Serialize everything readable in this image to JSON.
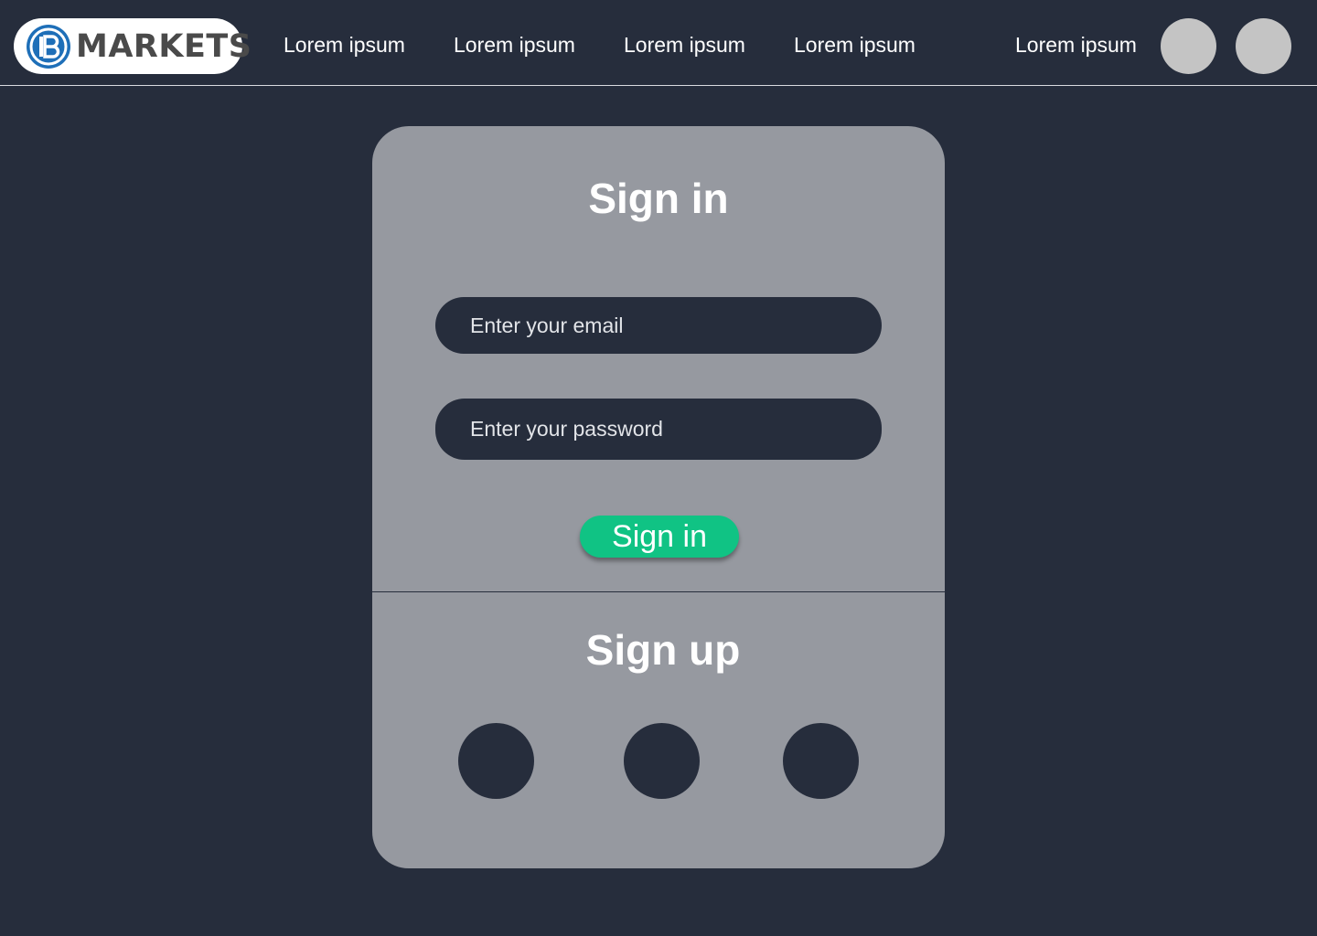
{
  "header": {
    "logo": {
      "text": "MARKETS",
      "mark_color": "#1e6fb8"
    },
    "nav": [
      {
        "label": "Lorem ipsum"
      },
      {
        "label": "Lorem ipsum"
      },
      {
        "label": "Lorem ipsum"
      },
      {
        "label": "Lorem ipsum"
      },
      {
        "label": "Lorem ipsum"
      }
    ]
  },
  "signin": {
    "title": "Sign in",
    "email_placeholder": "Enter your email",
    "password_placeholder": "Enter your password",
    "button_label": "Sign in",
    "button_color": "#10c384"
  },
  "signup": {
    "title": "Sign up"
  },
  "colors": {
    "background": "#262d3c",
    "card": "#9699a0",
    "avatar": "#c4c4c4"
  }
}
